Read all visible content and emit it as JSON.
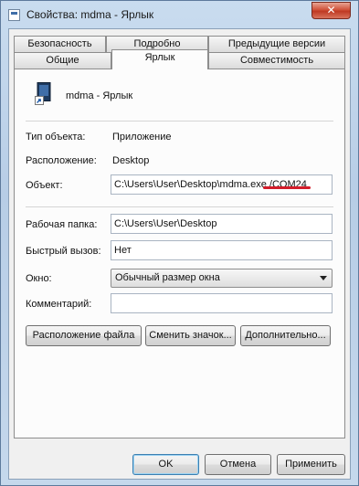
{
  "window": {
    "title": "Свойства: mdma - Ярлык",
    "close_glyph": "✕"
  },
  "tabs": {
    "back_row": [
      "Безопасность",
      "Подробно",
      "Предыдущие версии"
    ],
    "front_row": [
      "Общие",
      "Ярлык",
      "Совместимость"
    ],
    "active": "Ярлык"
  },
  "shortcut": {
    "name": "mdma - Ярлык",
    "icon": "shortcut-file-icon",
    "type_label": "Тип объекта:",
    "type_value": "Приложение",
    "location_label": "Расположение:",
    "location_value": "Desktop",
    "target_label": "Объект:",
    "target_value": "C:\\Users\\User\\Desktop\\mdma.exe /COM24",
    "start_in_label": "Рабочая папка:",
    "start_in_value": "C:\\Users\\User\\Desktop",
    "hotkey_label": "Быстрый вызов:",
    "hotkey_value": "Нет",
    "run_label": "Окно:",
    "run_value": "Обычный размер окна",
    "comment_label": "Комментарий:",
    "comment_value": ""
  },
  "actions": {
    "open_location": "Расположение файла",
    "change_icon": "Сменить значок...",
    "advanced": "Дополнительно..."
  },
  "dialog_buttons": {
    "ok": "OK",
    "cancel": "Отмена",
    "apply": "Применить"
  },
  "colors": {
    "highlight_underline": "#d31c2a",
    "title_bar": "#b7cde6",
    "close_button": "#c8452d"
  }
}
